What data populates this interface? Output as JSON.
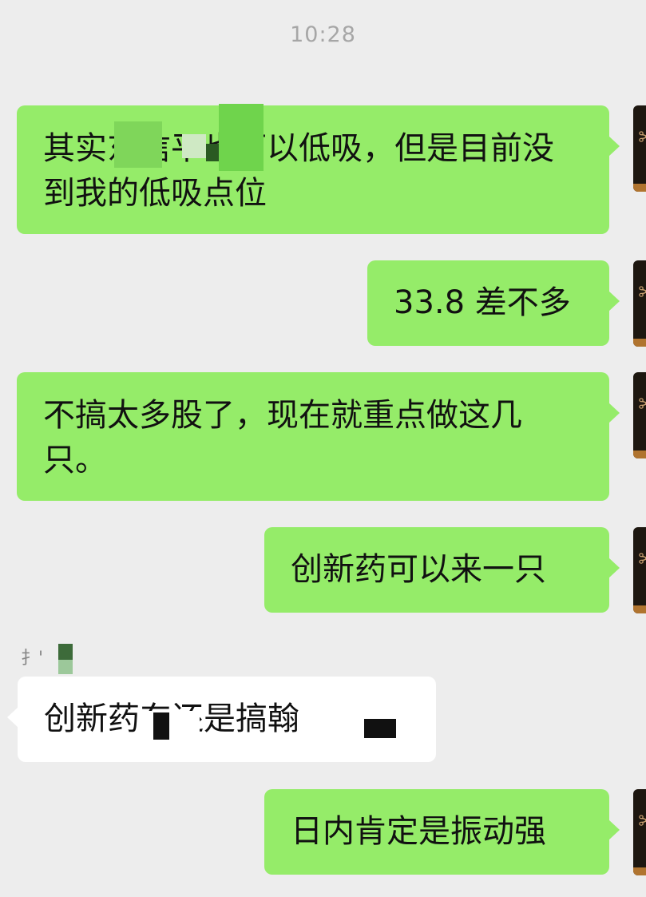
{
  "timestamp": "10:28",
  "messages": [
    {
      "side": "right",
      "text": "其实东信平也可以低吸，但是目前没到我的低吸点位"
    },
    {
      "side": "right",
      "text": "33.8 差不多"
    },
    {
      "side": "right",
      "text": "不搞太多股了，现在就重点做这几只。"
    },
    {
      "side": "right",
      "text": "创新药可以来一只"
    },
    {
      "side": "left",
      "sender": "扌'",
      "text": "创新药东还是搞翰"
    },
    {
      "side": "right",
      "text": "日内肯定是振动强"
    }
  ],
  "avatar": {
    "icon": "scissors-avatar-icon"
  },
  "colors": {
    "background": "#ededed",
    "self_bubble": "#95ec69",
    "other_bubble": "#ffffff",
    "timestamp": "#a6a6a6"
  }
}
